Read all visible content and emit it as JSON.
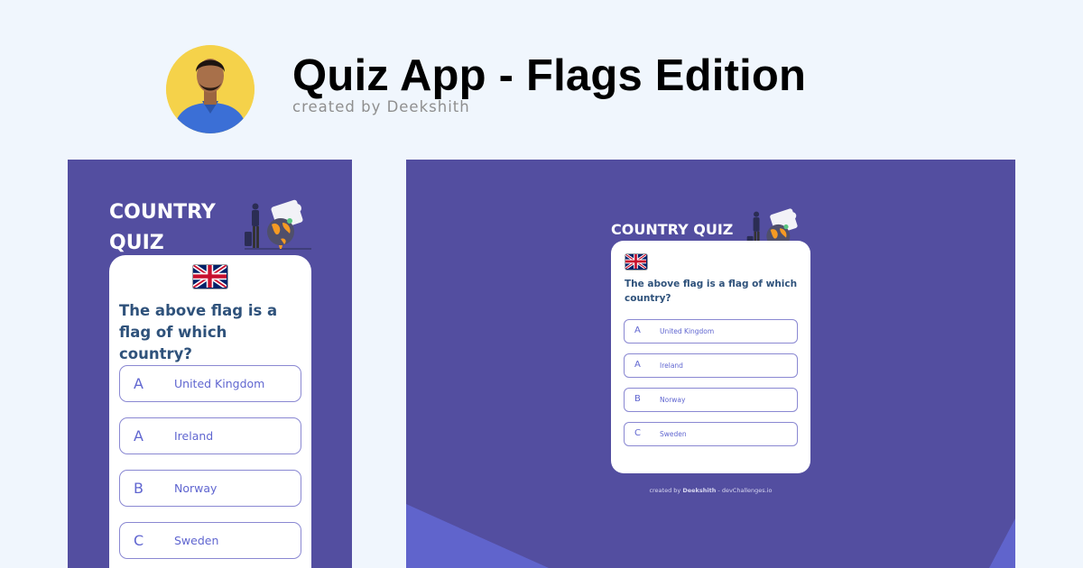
{
  "header": {
    "title": "Quiz App - Flags Edition",
    "subtitle": "created by Deekshith"
  },
  "quiz": {
    "brand": "COUNTRY QUIZ",
    "brand_line1": "COUNTRY",
    "brand_line2": "QUIZ",
    "flag_icon": "united-kingdom-flag",
    "question": "The above flag is a flag of which country?",
    "options": [
      {
        "letter": "A",
        "label": "United Kingdom"
      },
      {
        "letter": "A",
        "label": "Ireland"
      },
      {
        "letter": "B",
        "label": "Norway"
      },
      {
        "letter": "C",
        "label": "Sweden"
      }
    ]
  },
  "footer": {
    "prefix": "created by",
    "author": "Deekshith",
    "site": "- devChallenges.io"
  },
  "colors": {
    "page_bg": "#f0f6fd",
    "panel_bg": "#534ea0",
    "accent_shape": "#6064cc",
    "question_text": "#2f527b",
    "option_border": "#8a88d2",
    "avatar_bg": "#f5d24a"
  }
}
